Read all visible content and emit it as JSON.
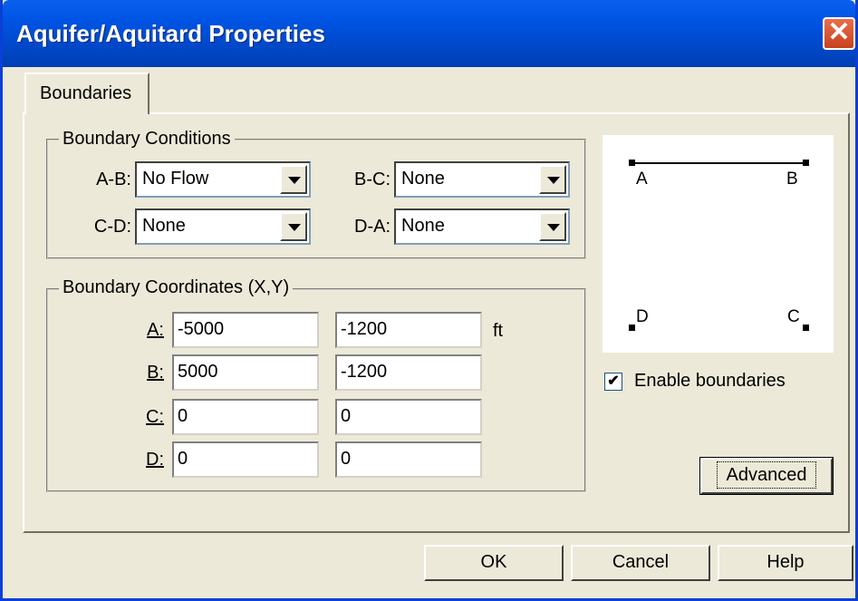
{
  "window": {
    "title": "Aquifer/Aquitard Properties",
    "close_glyph": "✕"
  },
  "tabs": [
    {
      "label": "Boundaries"
    }
  ],
  "conditions": {
    "title": "Boundary Conditions",
    "ab": {
      "label": "A-B:",
      "value": "No Flow"
    },
    "bc": {
      "label": "B-C:",
      "value": "None"
    },
    "cd": {
      "label": "C-D:",
      "value": "None"
    },
    "da": {
      "label": "D-A:",
      "value": "None"
    }
  },
  "coordinates": {
    "title": "Boundary Coordinates (X,Y)",
    "unit": "ft",
    "rows": [
      {
        "label": "A:",
        "x": "-5000",
        "y": "-1200"
      },
      {
        "label": "B:",
        "x": "5000",
        "y": "-1200"
      },
      {
        "label": "C:",
        "x": "0",
        "y": "0"
      },
      {
        "label": "D:",
        "x": "0",
        "y": "0"
      }
    ]
  },
  "preview": {
    "a": "A",
    "b": "B",
    "c": "C",
    "d": "D"
  },
  "enable": {
    "label": "Enable boundaries",
    "checked": true,
    "check_glyph": "✔"
  },
  "buttons": {
    "advanced": "Advanced",
    "ok": "OK",
    "cancel": "Cancel",
    "help": "Help"
  }
}
